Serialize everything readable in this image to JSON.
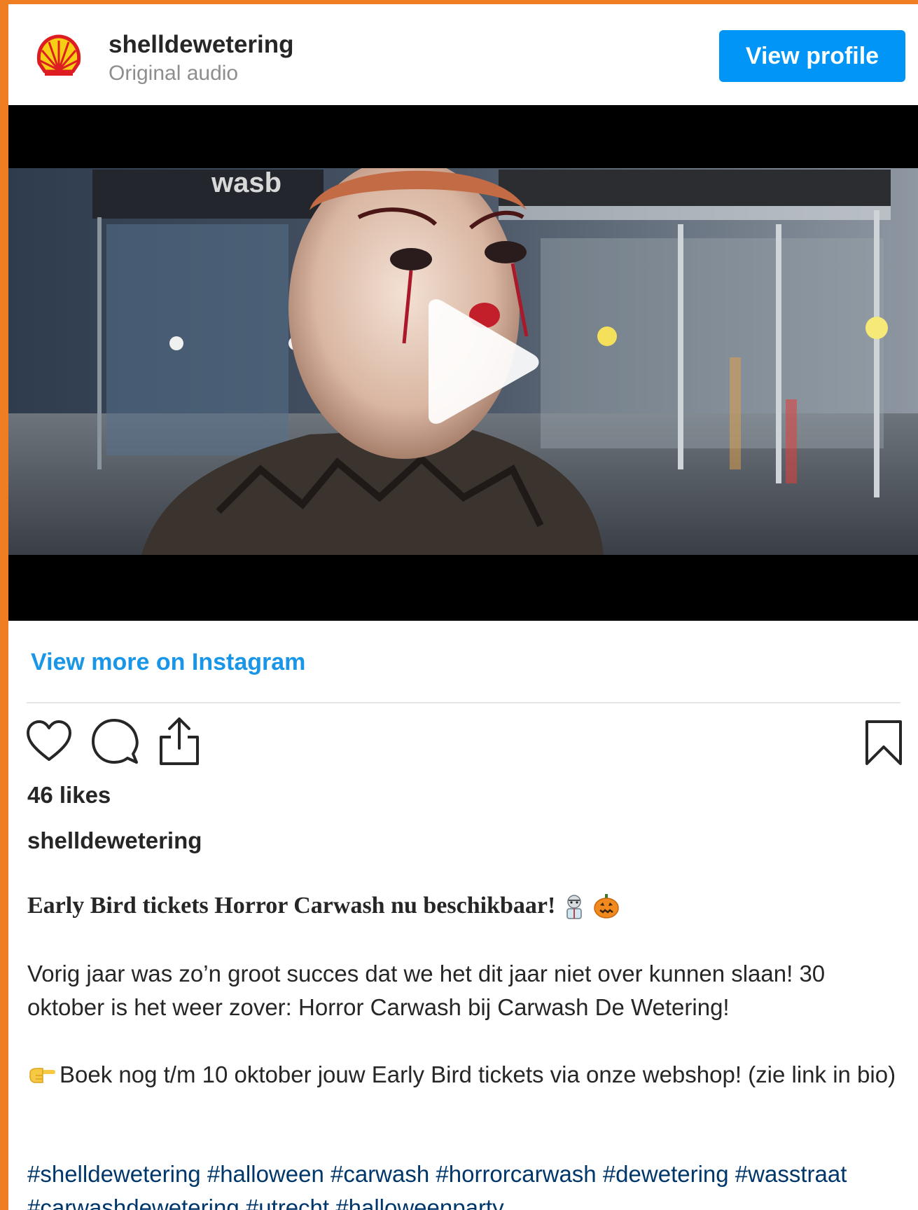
{
  "header": {
    "username": "shelldewetering",
    "subtitle": "Original audio",
    "view_profile_label": "View profile"
  },
  "video": {
    "sign_left": "wasb"
  },
  "view_more_label": "View more on Instagram",
  "likes_text": "46 likes",
  "caption": {
    "username": "shelldewetering",
    "headline": "Early Bird tickets Horror Carwash nu beschikbaar!",
    "paragraph1": "Vorig jaar was zo’n groot succes dat we het dit jaar niet over kunnen slaan! 30 oktober is het weer zover: Horror Carwash bij Carwash De Wetering!",
    "paragraph2": "Boek nog t/m 10 oktober jouw Early Bird tickets via onze webshop! (zie link in bio)",
    "hashtags": [
      "#shelldewetering",
      "#halloween",
      "#carwash",
      "#horrorcarwash",
      "#dewetering",
      "#wasstraat",
      "#carwashdewetering",
      "#utrecht",
      "#halloweenparty"
    ]
  },
  "icons": {
    "logo": "shell-logo-icon",
    "play": "play-icon",
    "like": "heart-icon",
    "comment": "comment-icon",
    "share": "share-icon",
    "save": "bookmark-icon",
    "headline_emojis": [
      "zombie-emoji-icon",
      "pumpkin-emoji-icon"
    ],
    "pointing": "pointing-hand-emoji-icon"
  },
  "colors": {
    "page_border": "#ef7d22",
    "button_blue": "#0095f6",
    "link_blue": "#1a96e8",
    "hashtag_blue": "#00376b"
  }
}
